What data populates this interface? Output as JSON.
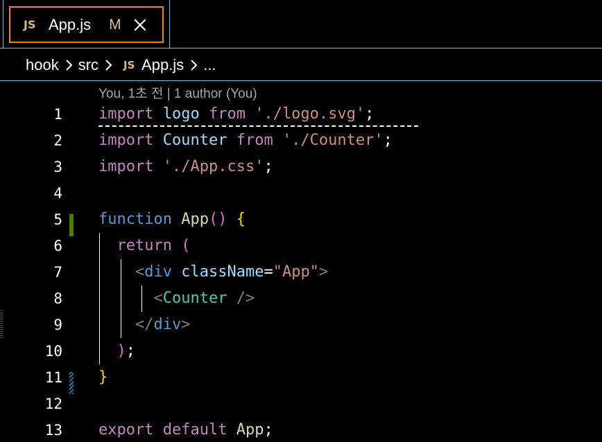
{
  "tab": {
    "icon_label": "JS",
    "filename": "App.js",
    "modified_badge": "M",
    "close_icon": "close-icon"
  },
  "breadcrumb": {
    "items": [
      "hook",
      "src",
      "App.js",
      "..."
    ],
    "file_icon_label": "JS",
    "separator_icon": "chevron-right-icon"
  },
  "codelens": "You, 1초 전 | 1 author (You)",
  "line_numbers": [
    "1",
    "2",
    "3",
    "4",
    "5",
    "6",
    "7",
    "8",
    "9",
    "10",
    "11",
    "12",
    "13"
  ],
  "code": {
    "l1": {
      "kw_import": "import",
      "ident": "logo",
      "kw_from": "from",
      "str": "'./logo.svg'",
      "semi": ";"
    },
    "l2": {
      "kw_import": "import",
      "ident": "Counter",
      "kw_from": "from",
      "str": "'./Counter'",
      "semi": ";"
    },
    "l3": {
      "kw_import": "import",
      "str": "'./App.css'",
      "semi": ";"
    },
    "l5": {
      "kw_function": "function",
      "name": "App",
      "parens": "()",
      "brace": "{"
    },
    "l6": {
      "kw_return": "return",
      "paren": "("
    },
    "l7": {
      "lt": "<",
      "tag": "div",
      "attr": "className",
      "eq": "=",
      "str": "\"App\"",
      "gt": ">"
    },
    "l8": {
      "lt": "<",
      "comp": "Counter",
      "close": "/>"
    },
    "l9": {
      "lt": "</",
      "tag": "div",
      "gt": ">"
    },
    "l10": {
      "paren": ")",
      "semi": ";"
    },
    "l11": {
      "brace": "}"
    },
    "l13": {
      "kw_export": "export",
      "kw_default": "default",
      "ident": "App",
      "semi": ";"
    }
  },
  "colors": {
    "active_tab_border": "#f38518",
    "contrast_border": "#6fc3df",
    "modified_gutter": "#487e02"
  }
}
